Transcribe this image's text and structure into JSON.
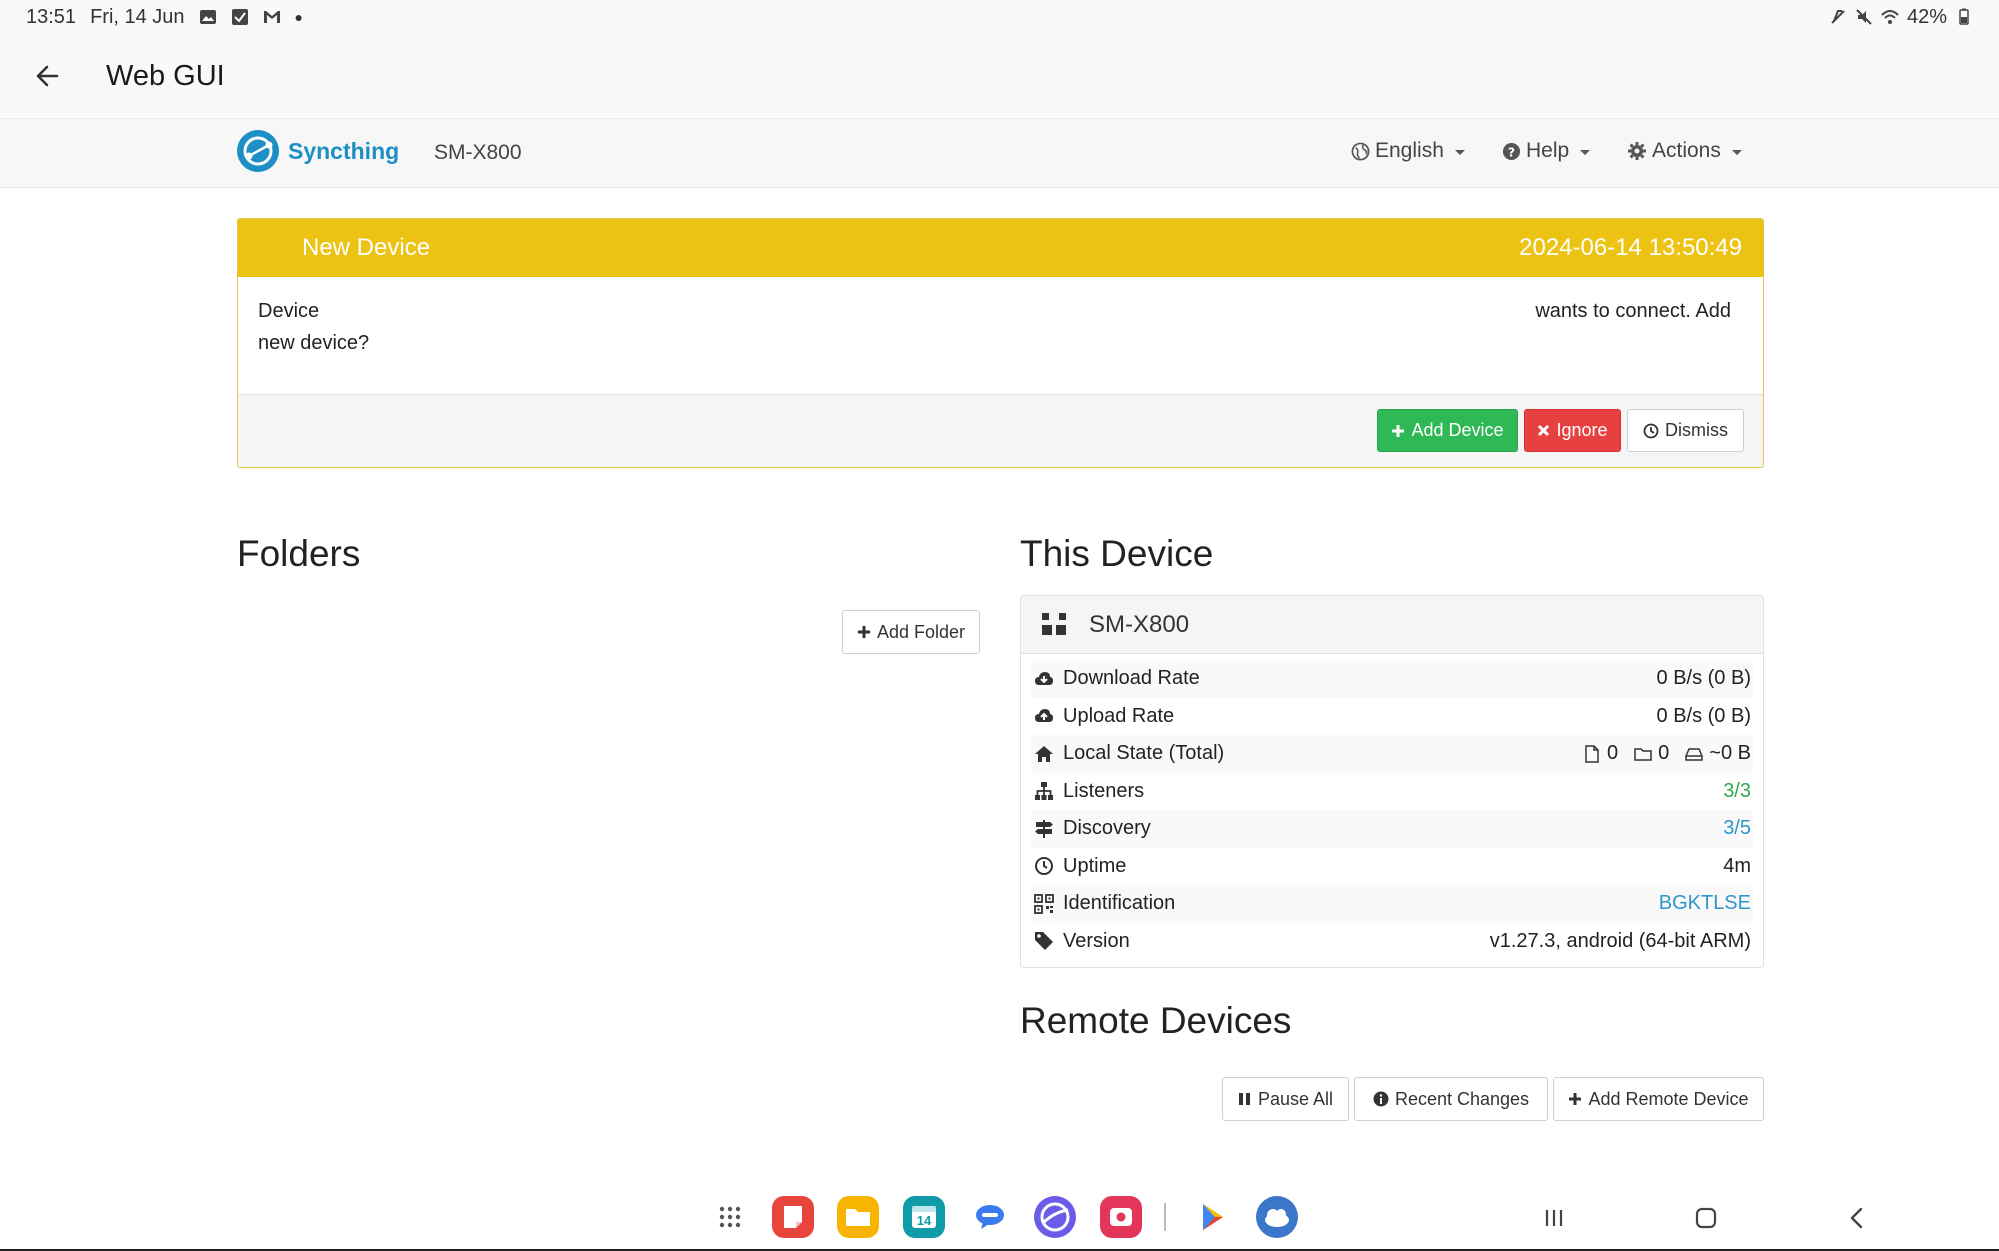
{
  "status_bar": {
    "time": "13:51",
    "date": "Fri, 14 Jun",
    "battery": "42%",
    "left_icons": [
      "image-icon",
      "checkbox-icon",
      "gmail-icon",
      "dot-icon"
    ],
    "right_icons": [
      "no-sim-icon",
      "mute-icon",
      "wifi-icon",
      "battery-icon"
    ]
  },
  "app_bar": {
    "title": "Web GUI",
    "back_icon": "arrow-left-icon"
  },
  "navbar": {
    "brand": "Syncthing",
    "device_name": "SM-X800",
    "language_menu": "English",
    "help_menu": "Help",
    "actions_menu": "Actions"
  },
  "notification": {
    "title": "New Device",
    "timestamp": "2024-06-14 13:50:49",
    "line1_left": "Device",
    "line1_right": "wants to connect. Add",
    "line2": "new device?",
    "add_button": "Add Device",
    "ignore_button": "Ignore",
    "dismiss_button": "Dismiss",
    "colors": {
      "header": "#ecc312",
      "success": "#2fb856",
      "danger": "#e64040"
    }
  },
  "folders": {
    "heading": "Folders",
    "add_button": "Add Folder"
  },
  "this_device": {
    "heading": "This Device",
    "name": "SM-X800",
    "rows": [
      {
        "label": "Download Rate",
        "value": "0 B/s (0 B)",
        "icon": "cloud-download-icon"
      },
      {
        "label": "Upload Rate",
        "value": "0 B/s (0 B)",
        "icon": "cloud-upload-icon"
      },
      {
        "label": "Local State (Total)",
        "files": "0",
        "folders": "0",
        "size": "~0 B",
        "icon": "home-icon"
      },
      {
        "label": "Listeners",
        "value": "3/3",
        "icon": "sitemap-icon"
      },
      {
        "label": "Discovery",
        "value": "3/5",
        "icon": "signpost-icon"
      },
      {
        "label": "Uptime",
        "value": "4m",
        "icon": "clock-icon"
      },
      {
        "label": "Identification",
        "value": "BGKTLSE",
        "icon": "qrcode-icon"
      },
      {
        "label": "Version",
        "value": "v1.27.3, android (64-bit ARM)",
        "icon": "tag-icon"
      }
    ]
  },
  "remote_devices": {
    "heading": "Remote Devices",
    "pause_all": "Pause All",
    "recent_changes": "Recent Changes",
    "add_remote": "Add Remote Device"
  },
  "dock": {
    "apps": [
      "apps-grid-icon",
      "notes-app-icon",
      "files-app-icon",
      "calendar-app-icon",
      "messages-app-icon",
      "internet-app-icon",
      "screen-recorder-app-icon",
      "play-store-icon",
      "syncthing-app-icon"
    ],
    "calendar_day": "14",
    "nav": [
      "recent-apps-icon",
      "home-nav-icon",
      "back-nav-icon"
    ]
  }
}
